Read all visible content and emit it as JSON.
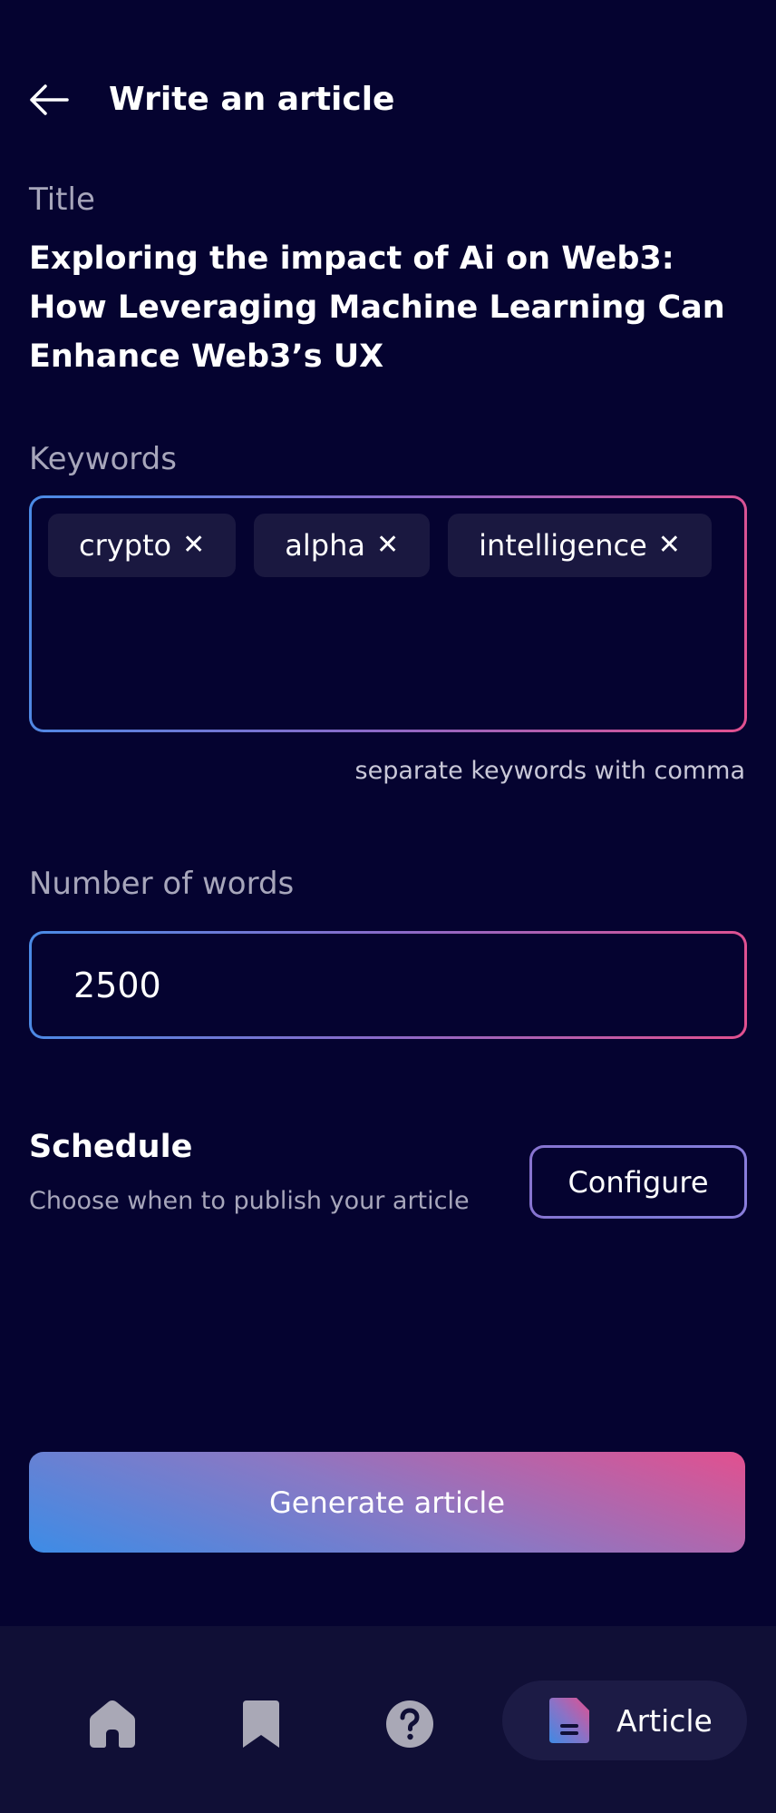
{
  "header": {
    "title": "Write an article",
    "back_icon": "arrow-left-icon"
  },
  "title_section": {
    "label": "Title",
    "value": "Exploring the impact of Ai on Web3: How Leveraging Machine Learning Can Enhance Web3’s UX"
  },
  "keywords_section": {
    "label": "Keywords",
    "chips": [
      {
        "label": "crypto",
        "remove_icon": "close-icon"
      },
      {
        "label": "alpha",
        "remove_icon": "close-icon"
      },
      {
        "label": "intelligence",
        "remove_icon": "close-icon"
      }
    ],
    "hint": "separate keywords with comma",
    "remove_glyph": "✕"
  },
  "words_section": {
    "label": "Number of words",
    "value": "2500"
  },
  "schedule_section": {
    "title": "Schedule",
    "subtitle": "Choose when to publish your article",
    "configure_label": "Configure"
  },
  "generate_label": "Generate article",
  "bottom_nav": {
    "items": [
      {
        "icon": "home-icon"
      },
      {
        "icon": "bookmark-icon"
      },
      {
        "icon": "help-icon"
      },
      {
        "icon": "article-icon",
        "label": "Article",
        "active": true
      }
    ]
  },
  "colors": {
    "background": "#050330",
    "nav_background": "#100f36",
    "chip_background": "#1a1840",
    "gradient_start": "#4a8be6",
    "gradient_end": "#e2508f",
    "muted_text": "#a7a6bb",
    "icon_gray": "#a9a8b6"
  }
}
